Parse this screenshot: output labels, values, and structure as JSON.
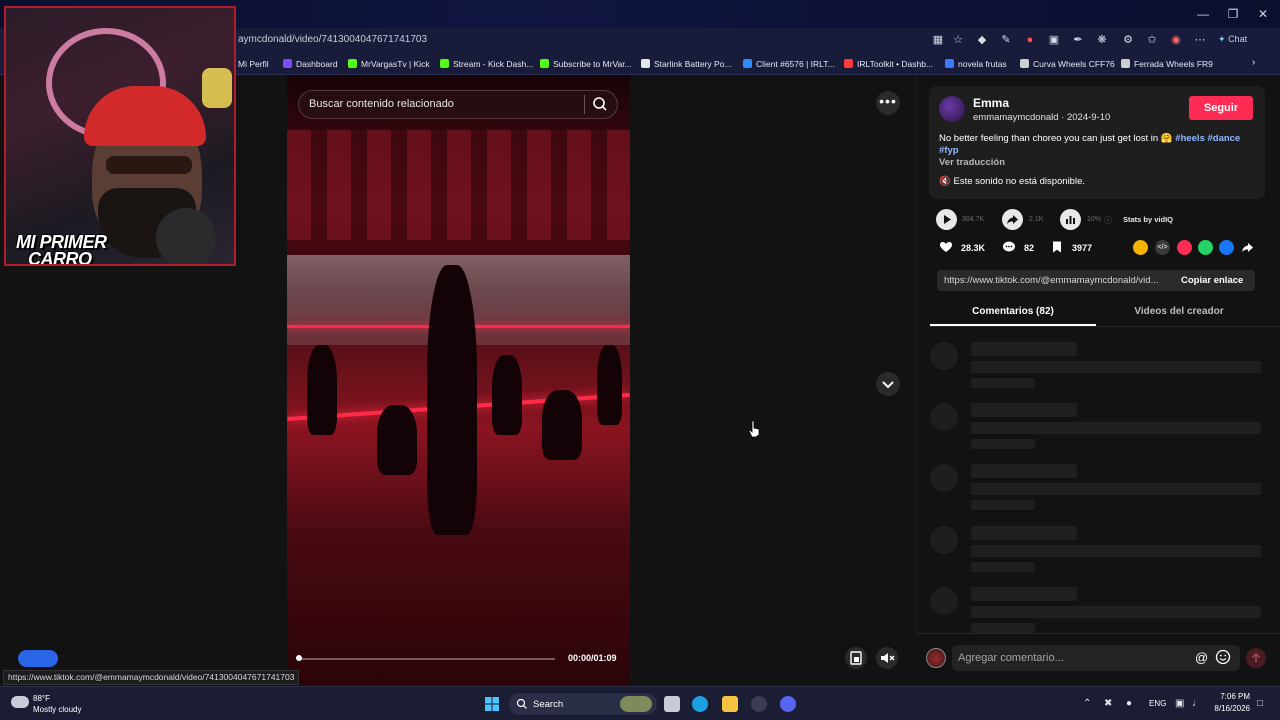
{
  "browser": {
    "url": "aymcdonald/video/7413004047671741703",
    "chat_label": "Chat",
    "bookmarks": [
      {
        "label": "Mi Perfil",
        "color": "#1a1a1a"
      },
      {
        "label": "Dashboard",
        "color": "#7a4cff"
      },
      {
        "label": "MrVargasTv | Kick",
        "color": "#53fc18"
      },
      {
        "label": "Stream - Kick Dash...",
        "color": "#53fc18"
      },
      {
        "label": "Subscribe to MrVar...",
        "color": "#53fc18"
      },
      {
        "label": "Starlink Battery Po...",
        "color": "#e6e6e6"
      },
      {
        "label": "Client #6576 | IRLT...",
        "color": "#2d8cff"
      },
      {
        "label": "IRLToolkit • Dashb...",
        "color": "#ff3b3b"
      },
      {
        "label": "novela frutas",
        "color": "#3a7bff"
      },
      {
        "label": "Curva Wheels CFF76",
        "color": "#cfcfcf"
      },
      {
        "label": "Ferrada Wheels FR9",
        "color": "#cfcfcf"
      }
    ]
  },
  "overlay": {
    "caption_line1": "MI PRIMER",
    "caption_line2": "CARRO"
  },
  "video": {
    "search_placeholder": "Buscar contenido relacionado",
    "time": "00:00/01:09",
    "progress": 0.0
  },
  "panel": {
    "author_name": "Emma",
    "author_handle": "emmamaymcdonald · 2024-9-10",
    "follow_label": "Seguir",
    "caption_text": "No better feeling than choreo you can just get lost in 🤗 ",
    "caption_tags": [
      "#heels",
      "#dance",
      "#fyp"
    ],
    "translate_label": "Ver traducción",
    "sound_text": "Este sonido no está disponible.",
    "stats": {
      "plays": "304.7K",
      "shares": "2.1K",
      "engagement": "10%",
      "stats_by": "Stats by vidIQ"
    },
    "likes": "28.3K",
    "comments": "82",
    "saves": "3977",
    "link": "https://www.tiktok.com/@emmamaymcdonald/vid...",
    "copy_label": "Copiar enlace",
    "tab_comments": "Comentarios (82)",
    "tab_videos": "Videos del creador",
    "comment_placeholder": "Agregar comentario..."
  },
  "status_url": "https://www.tiktok.com/@emmamaymcdonald/video/7413004047671741703",
  "taskbar": {
    "weather_temp": "88°F",
    "weather_desc": "Mostly cloudy",
    "search_label": "Search",
    "lang": "ENG",
    "time": "7:06 PM",
    "date": "8/16/2026"
  },
  "colors": {
    "accent": "#fe2c55",
    "tag": "#8fb9ff"
  }
}
